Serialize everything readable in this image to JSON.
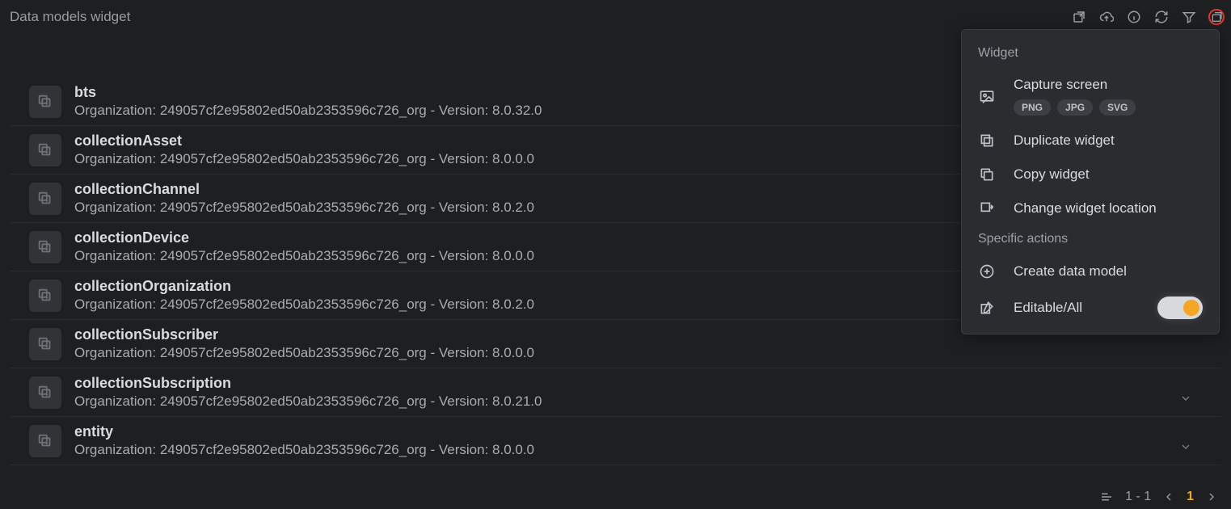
{
  "title": "Data models widget",
  "rows": [
    {
      "name": "bts",
      "org": "249057cf2e95802ed50ab2353596c726_org",
      "version": "8.0.32.0"
    },
    {
      "name": "collectionAsset",
      "org": "249057cf2e95802ed50ab2353596c726_org",
      "version": "8.0.0.0"
    },
    {
      "name": "collectionChannel",
      "org": "249057cf2e95802ed50ab2353596c726_org",
      "version": "8.0.2.0"
    },
    {
      "name": "collectionDevice",
      "org": "249057cf2e95802ed50ab2353596c726_org",
      "version": "8.0.0.0"
    },
    {
      "name": "collectionOrganization",
      "org": "249057cf2e95802ed50ab2353596c726_org",
      "version": "8.0.2.0"
    },
    {
      "name": "collectionSubscriber",
      "org": "249057cf2e95802ed50ab2353596c726_org",
      "version": "8.0.0.0"
    },
    {
      "name": "collectionSubscription",
      "org": "249057cf2e95802ed50ab2353596c726_org",
      "version": "8.0.21.0"
    },
    {
      "name": "entity",
      "org": "249057cf2e95802ed50ab2353596c726_org",
      "version": "8.0.0.0"
    }
  ],
  "row_sub_prefix": "Organization: ",
  "row_sub_sep": " - Version: ",
  "menu": {
    "section1": "Widget",
    "capture": "Capture screen",
    "badges": [
      "PNG",
      "JPG",
      "SVG"
    ],
    "duplicate": "Duplicate widget",
    "copy": "Copy widget",
    "location": "Change widget location",
    "section2": "Specific actions",
    "create": "Create data model",
    "editable": "Editable/All"
  },
  "footer": {
    "range": "1 - 1",
    "current": "1"
  }
}
